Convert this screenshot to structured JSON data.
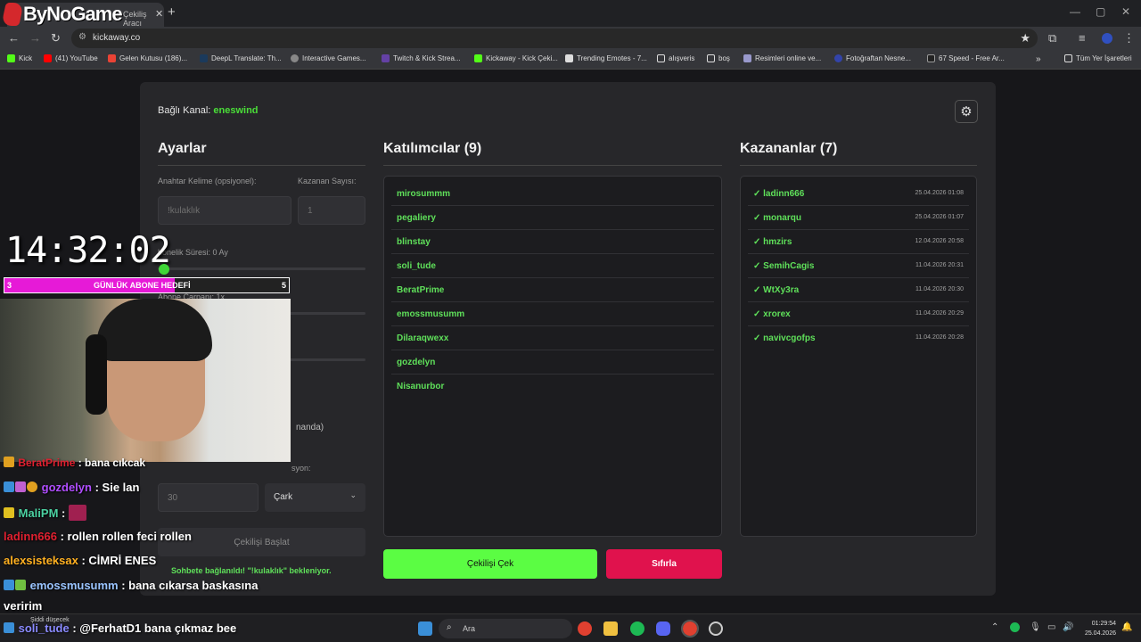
{
  "browser": {
    "tab_title": "Çekiliş Aracı",
    "brand": "ByNoGame",
    "url": "kickaway.co",
    "bookmarks": [
      {
        "label": "Kick",
        "color": "#53fc18"
      },
      {
        "label": "(41) YouTube",
        "color": "#ff0000"
      },
      {
        "label": "Gelen Kutusu (186)...",
        "color": "#ea4335"
      },
      {
        "label": "DeepL Translate: Th...",
        "color": "#0f2b46"
      },
      {
        "label": "Interactive Games...",
        "color": "#888888"
      },
      {
        "label": "Twitch & Kick Strea...",
        "color": "#6441a5"
      },
      {
        "label": "Kickaway - Kick Çeki...",
        "color": "#53fc18"
      },
      {
        "label": "Trending Emotes - 7...",
        "color": "#dddddd"
      },
      {
        "label": "alışveris",
        "color": "#dddddd"
      },
      {
        "label": "boş",
        "color": "#dddddd"
      },
      {
        "label": "Resimleri online ve...",
        "color": "#9999cc"
      },
      {
        "label": "Fotoğraftan Nesne...",
        "color": "#3344aa"
      },
      {
        "label": "67 Speed - Free Ar...",
        "color": "#222222"
      },
      {
        "label": "Tüm Yer İşaretleri",
        "color": "#dddddd"
      }
    ]
  },
  "app": {
    "connected_label": "Bağlı Kanal:",
    "connected_channel": "eneswind",
    "settings": {
      "title": "Ayarlar",
      "keyword_label": "Anahtar Kelime (opsiyonel):",
      "keyword_placeholder": "!kulaklık",
      "winner_count_label": "Kazanan Sayısı:",
      "winner_count_placeholder": "1",
      "sub_duration_label": "bonelik Süresi: 0 Ay",
      "sub_multiplier_label": "Abone Çarpanı: 1x",
      "partial_text_1": "nanda)",
      "partial_text_2": "syon:",
      "duration_value": "30",
      "animation_select": "Çark",
      "start_button": "Çekilişi Başlat",
      "status": "Sohbete bağlanıldı! \"!kulaklık\" bekleniyor."
    },
    "participants": {
      "title": "Katılımcılar (9)",
      "items": [
        "mirosummm",
        "pegaliery",
        "blinstay",
        "soli_tude",
        "BeratPrime",
        "emossmusumm",
        "Dilaraqwexx",
        "gozdelyn",
        "Nisanurbor"
      ]
    },
    "winners": {
      "title": "Kazananlar (7)",
      "items": [
        {
          "name": "✓ ladinn666",
          "date": "25.04.2026 01:08"
        },
        {
          "name": "✓ monarqu",
          "date": "25.04.2026 01:07"
        },
        {
          "name": "✓ hmzirs",
          "date": "12.04.2026 20:58"
        },
        {
          "name": "✓ SemihCagis",
          "date": "11.04.2026 20:31"
        },
        {
          "name": "✓ WtXy3ra",
          "date": "11.04.2026 20:30"
        },
        {
          "name": "✓ xrorex",
          "date": "11.04.2026 20:29"
        },
        {
          "name": "✓ navivcgofps",
          "date": "11.04.2026 20:28"
        }
      ]
    },
    "draw_button": "Çekilişi Çek",
    "reset_button": "Sıfırla"
  },
  "overlay": {
    "clock": "14:32:02",
    "goal_label": "GÜNLÜK ABONE HEDEFİ",
    "goal_current": "3",
    "goal_target": "5",
    "goal_progress": 0.6,
    "chat": [
      {
        "user": "BeratPrime",
        "sep": " : ",
        "msg": "bana cıkcak",
        "color": "#e02030"
      },
      {
        "user": "gozdelyn",
        "sep": " : ",
        "msg": "Sie lan",
        "color": "#b04dff"
      },
      {
        "user": "MaliPM",
        "sep": " : ",
        "msg": "",
        "color": "#4ad0a0"
      },
      {
        "user": "ladinn666",
        "sep": " : ",
        "msg": "rollen rollen feci rollen",
        "color": "#e02030"
      },
      {
        "user": "alexsisteksax",
        "sep": " : ",
        "msg": "CİMRİ ENES",
        "color": "#ffb020"
      },
      {
        "user": "emossmusumm",
        "sep": " : ",
        "msg": "bana cıkarsa baskasına",
        "color": "#9ac4ff"
      },
      {
        "user": "",
        "sep": "",
        "msg": "veririm",
        "color": "#ffffff"
      },
      {
        "user": "soli_tude",
        "sep": " : ",
        "msg": "@FerhatD1 bana çıkmaz bee",
        "color": "#8a8aff"
      }
    ]
  },
  "taskbar": {
    "search_placeholder": "Ara",
    "time": "01:29:54",
    "date": "25.04.2026",
    "notif_title": "Şiddi düşecek"
  }
}
